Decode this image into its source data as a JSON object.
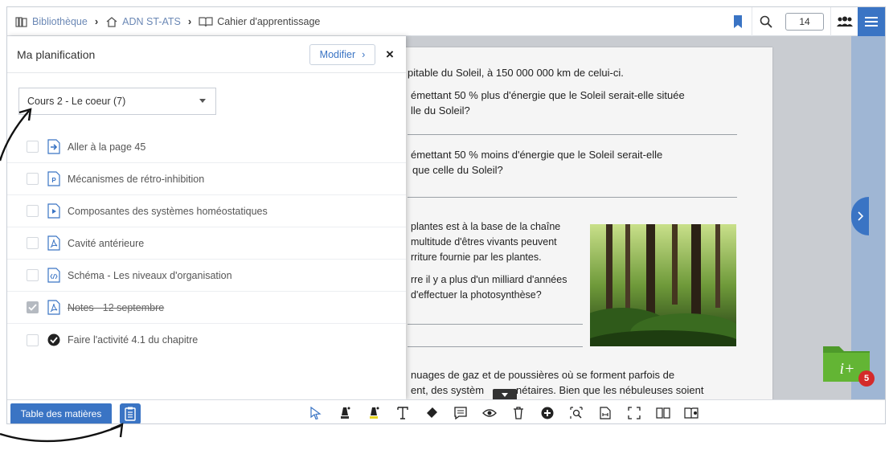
{
  "breadcrumb": {
    "library": "Bibliothèque",
    "book": "ADN ST-ATS",
    "notebook": "Cahier d'apprentissage"
  },
  "topbar": {
    "page_number": "14"
  },
  "panel": {
    "title": "Ma planification",
    "modify_label": "Modifier",
    "course_select": "Cours 2 - Le coeur (7)",
    "items": [
      {
        "label": "Aller à la page 45",
        "icon": "goto-page-icon",
        "checked": false
      },
      {
        "label": "Mécanismes de rétro-inhibition",
        "icon": "p-document-icon",
        "checked": false
      },
      {
        "label": "Composantes des systèmes homéostatiques",
        "icon": "video-icon",
        "checked": false
      },
      {
        "label": "Cavité antérieure",
        "icon": "pdf-icon",
        "checked": false
      },
      {
        "label": "Schéma - Les niveaux d'organisation",
        "icon": "code-document-icon",
        "checked": false
      },
      {
        "label": "Notes - 12 septembre",
        "icon": "pdf-icon",
        "checked": true
      },
      {
        "label": "Faire l'activité 4.1 du chapitre",
        "icon": "check-circle-icon",
        "checked": false
      }
    ]
  },
  "page": {
    "line1": "pitable du Soleil, à 150 000 000 km de celui-ci.",
    "q1_line1": "émettant 50 % plus d'énergie que le Soleil serait-elle située",
    "q1_line2": "lle du Soleil?",
    "q2_line1": "émettant 50 % moins d'énergie que le Soleil serait-elle",
    "q2_line2": "que celle du Soleil?",
    "p3_line1": "plantes est à la base de la chaîne",
    "p3_line2": "multitude d'êtres vivants peuvent",
    "p3_line3": "rriture fournie par les plantes.",
    "p4_line1": "rre il y a plus d'un milliard d'années",
    "p4_line2": "d'effectuer la photosynthèse?",
    "p5_line1": "nuages de gaz et de poussières où se forment parfois de",
    "p5_line2a": "ent, des systèm",
    "p5_line2b": "nétaires. Bien que les nébuleuses soient"
  },
  "folder": {
    "label": "i+",
    "badge": "5"
  },
  "bottombar": {
    "toc_label": "Table des matières",
    "tools": [
      "select-arrow-icon",
      "pen-icon",
      "highlighter-icon",
      "text-icon",
      "eraser-icon",
      "note-icon",
      "eye-icon",
      "trash-icon",
      "add-circle-icon",
      "zoom-area-icon",
      "fit-page-icon",
      "fullscreen-icon",
      "single-page-icon",
      "double-page-icon"
    ]
  },
  "colors": {
    "accent": "#3a74c4",
    "folder_green": "#5aa832",
    "badge_red": "#d42a2a"
  }
}
